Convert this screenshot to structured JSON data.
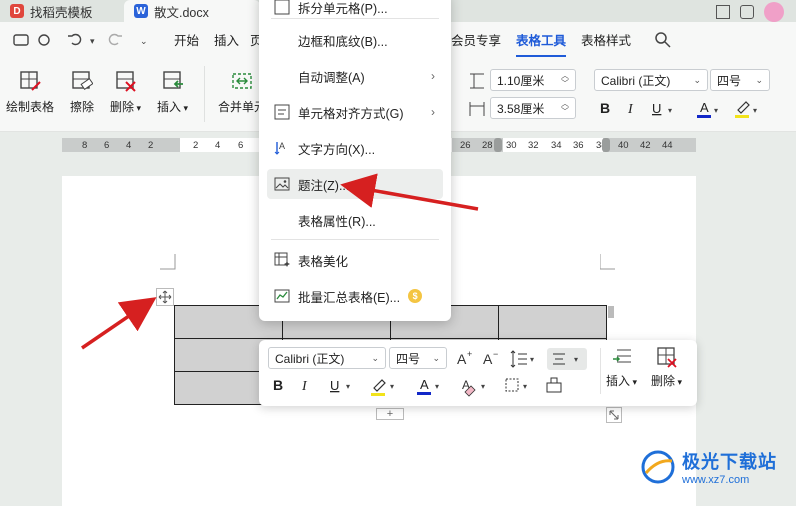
{
  "tabs": [
    {
      "label": "找稻壳模板"
    },
    {
      "label": "散文.docx"
    }
  ],
  "menu": {
    "start": "开始",
    "insert": "插入",
    "page_partial": "页",
    "member": "会员专享",
    "table_tools": "表格工具",
    "table_style": "表格样式"
  },
  "ribbon": {
    "draw_table": "绘制表格",
    "erase": "擦除",
    "delete": "删除",
    "insert": "插入",
    "merge": "合并单元",
    "height": "1.10厘米",
    "width": "3.58厘米",
    "font": "Calibri (正文)",
    "size": "四号"
  },
  "ruler": [
    "8",
    "6",
    "4",
    "2",
    "2",
    "4",
    "6",
    "26",
    "28",
    "30",
    "32",
    "34",
    "36",
    "38",
    "40",
    "42",
    "44"
  ],
  "context_menu": {
    "top_partial": "拆分单元格(P)...",
    "borders": "边框和底纹(B)...",
    "autofit": "自动调整(A)",
    "align": "单元格对齐方式(G)",
    "direction": "文字方向(X)...",
    "caption": "题注(Z)...",
    "props": "表格属性(R)...",
    "beautify": "表格美化",
    "batch": "批量汇总表格(E)..."
  },
  "float_toolbar": {
    "font": "Calibri (正文)",
    "size": "四号",
    "insert": "插入",
    "delete": "删除"
  },
  "watermark": {
    "name": "极光下载站",
    "url": "www.xz7.com"
  },
  "colors": {
    "accent": "#1f5bd8",
    "arrow": "#d62020",
    "font_color_bar": "#1228c8",
    "highlight_bar": "#f2e31a",
    "cell_fill": "#d1d1d1"
  }
}
